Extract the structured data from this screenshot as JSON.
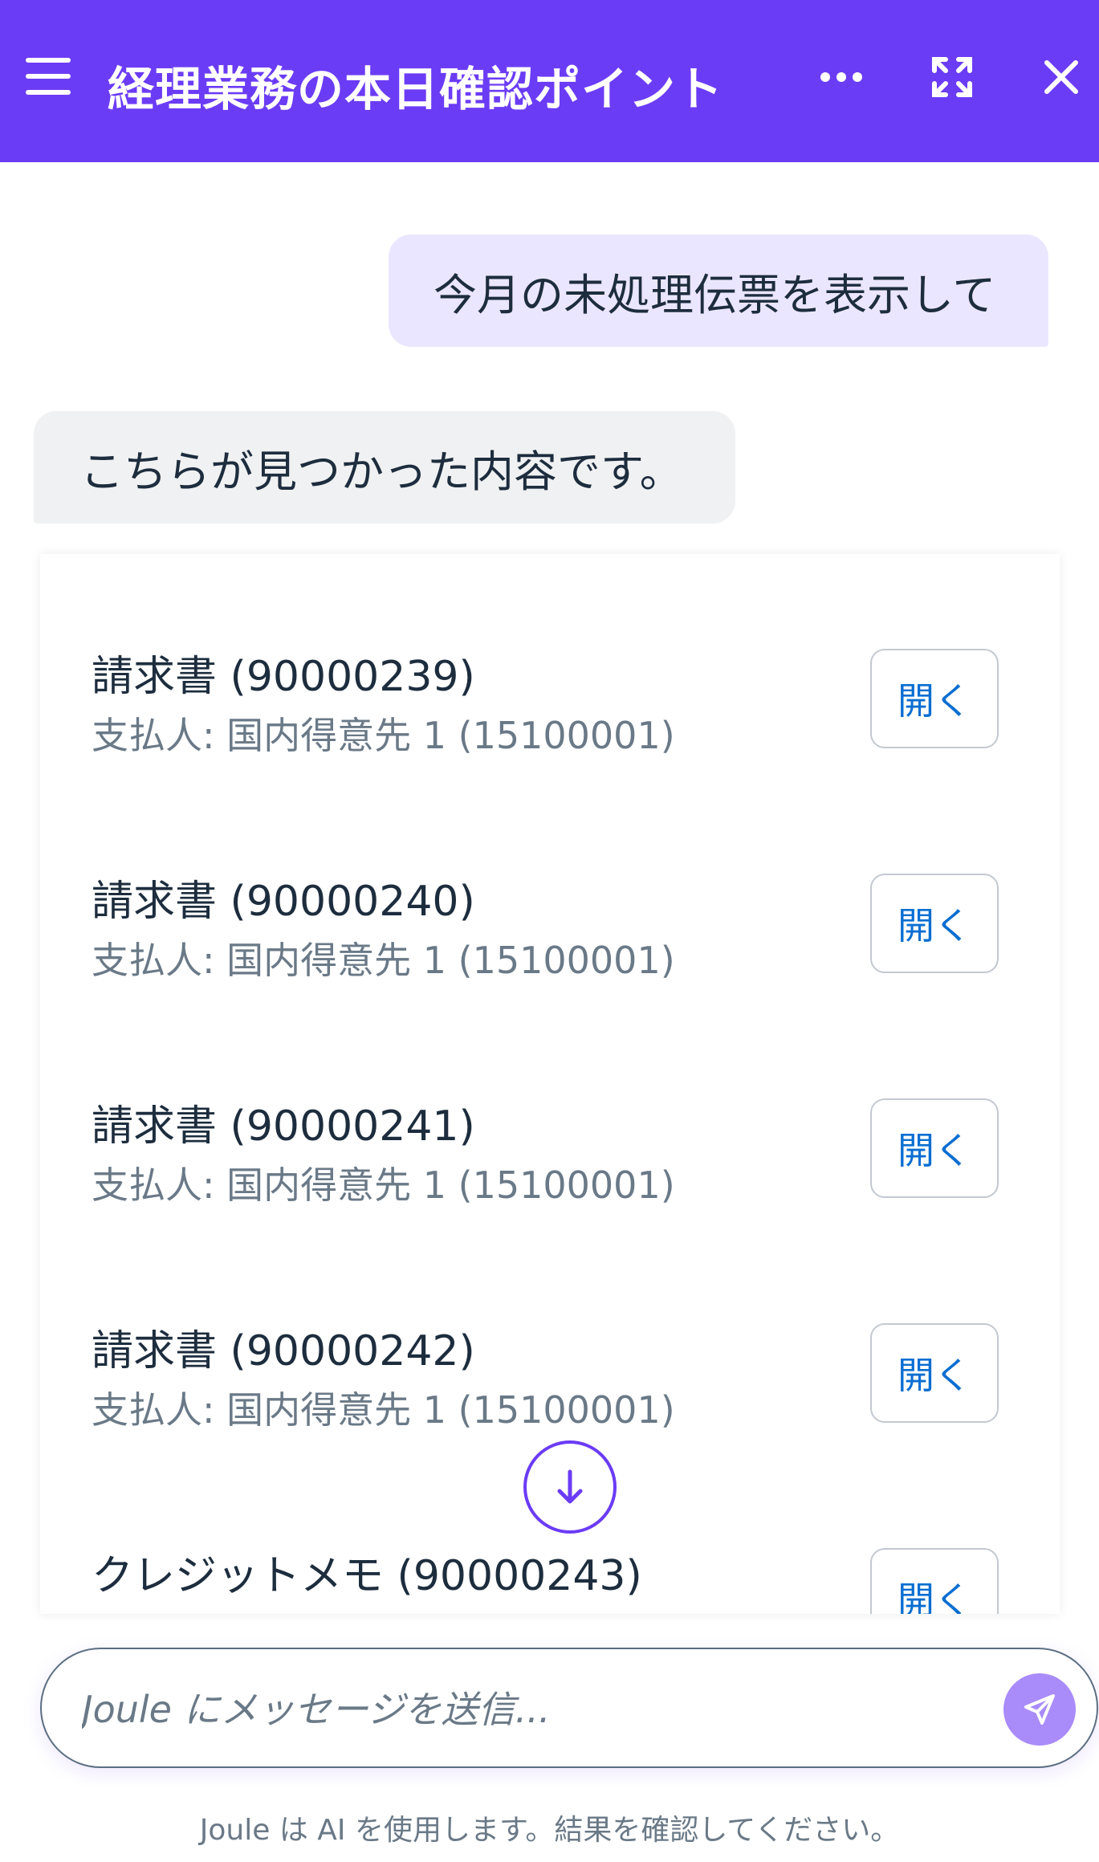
{
  "header": {
    "title": "経理業務の本日確認ポイント",
    "menu_icon": "hamburger-icon",
    "more_icon": "more-horizontal-icon",
    "expand_icon": "fullscreen-icon",
    "close_icon": "close-icon",
    "background_color": "#6b3cf5"
  },
  "messages": {
    "user": "今月の未処理伝票を表示して",
    "assistant": "こちらが見つかった内容です。"
  },
  "results": {
    "open_label": "開く",
    "items": [
      {
        "title": "請求書 (90000239)",
        "subtitle": "支払人: 国内得意先 1 (15100001)"
      },
      {
        "title": "請求書 (90000240)",
        "subtitle": "支払人: 国内得意先 1 (15100001)"
      },
      {
        "title": "請求書 (90000241)",
        "subtitle": "支払人: 国内得意先 1 (15100001)"
      },
      {
        "title": "請求書 (90000242)",
        "subtitle": "支払人: 国内得意先 1 (15100001)"
      },
      {
        "title": "クレジットメモ (90000243)",
        "subtitle": ""
      }
    ]
  },
  "composer": {
    "placeholder": "Joule にメッセージを送信...",
    "send_icon": "send-icon",
    "scroll_icon": "arrow-down-icon"
  },
  "disclaimer": "Joule は AI を使用します。結果を確認してください。"
}
